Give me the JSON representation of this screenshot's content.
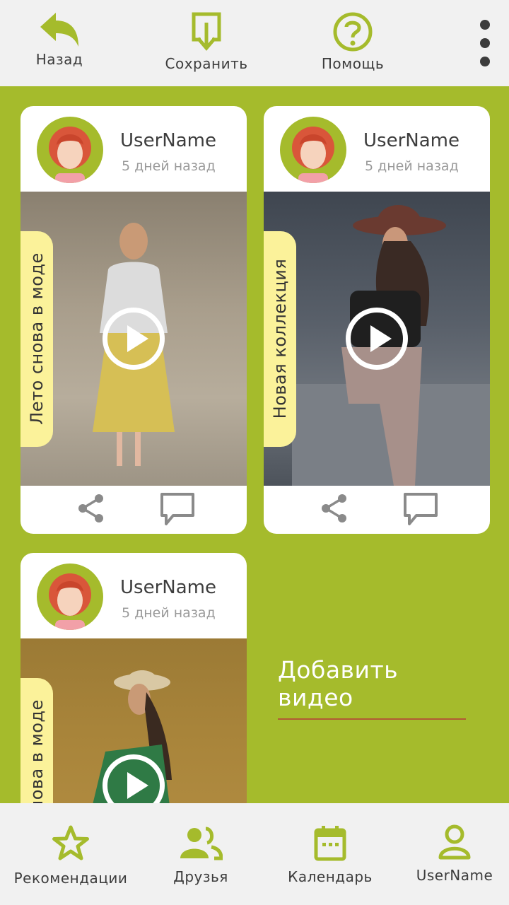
{
  "toolbar": {
    "back_label": "Назад",
    "save_label": "Сохранить",
    "help_label": "Помощь"
  },
  "colors": {
    "accent": "#a5bb2c",
    "tag": "#fbf29a",
    "bar": "#f1f1f1",
    "text": "#3c3c3c"
  },
  "cards": [
    {
      "username": "UserName",
      "time": "5 дней назад",
      "tag": "Лето снова в моде"
    },
    {
      "username": "UserName",
      "time": "5 дней назад",
      "tag": "Новая коллекция"
    },
    {
      "username": "UserName",
      "time": "5 дней назад",
      "tag": "Лето снова в моде"
    }
  ],
  "add_video_label": "Добавить видео",
  "bottom_nav": {
    "items": [
      {
        "label": "Рекомендации",
        "icon": "star-icon"
      },
      {
        "label": "Друзья",
        "icon": "friends-icon"
      },
      {
        "label": "Календарь",
        "icon": "calendar-icon"
      },
      {
        "label": "UserName",
        "icon": "user-icon"
      }
    ]
  }
}
